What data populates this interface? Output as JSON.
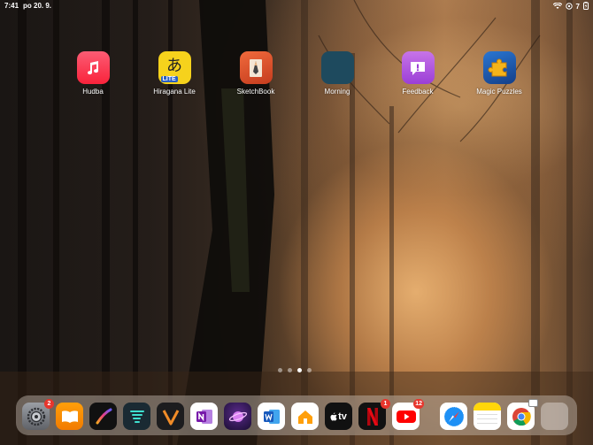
{
  "status": {
    "time": "7:41",
    "date": "po 20. 9.",
    "battery": "7"
  },
  "apps": [
    {
      "name": "Hudba",
      "icon": "music-icon"
    },
    {
      "name": "Hiragana Lite",
      "icon": "hiragana-icon",
      "glyph": "あ",
      "sub": "LITE"
    },
    {
      "name": "SketchBook",
      "icon": "pencil-icon"
    },
    {
      "name": "Morning",
      "icon": "morning-icon"
    },
    {
      "name": "Feedback",
      "icon": "feedback-icon"
    },
    {
      "name": "Magic Puzzles",
      "icon": "puzzle-icon"
    }
  ],
  "page_dots": {
    "count": 4,
    "active": 3
  },
  "dock": {
    "apps": [
      {
        "name": "settings",
        "icon": "gear-icon",
        "badge": "2"
      },
      {
        "name": "books",
        "icon": "book-icon"
      },
      {
        "name": "procreate",
        "icon": "brush-icon"
      },
      {
        "name": "tornado",
        "icon": "tornado-icon"
      },
      {
        "name": "vectornator",
        "icon": "vector-icon"
      },
      {
        "name": "onenote",
        "icon": "onenote-icon"
      },
      {
        "name": "planet",
        "icon": "planet-icon"
      },
      {
        "name": "word",
        "icon": "word-icon"
      },
      {
        "name": "home",
        "icon": "home-icon"
      },
      {
        "name": "apple-tv",
        "icon": "tv-icon",
        "label": "tv"
      },
      {
        "name": "netflix",
        "icon": "netflix-icon",
        "badge": "1"
      },
      {
        "name": "youtube",
        "icon": "youtube-icon",
        "badge": "12"
      },
      {
        "name": "safari",
        "icon": "compass-icon"
      },
      {
        "name": "notes",
        "icon": "notes-icon"
      },
      {
        "name": "chrome",
        "icon": "chrome-icon"
      },
      {
        "name": "app-library",
        "icon": "app-library-icon"
      }
    ]
  }
}
